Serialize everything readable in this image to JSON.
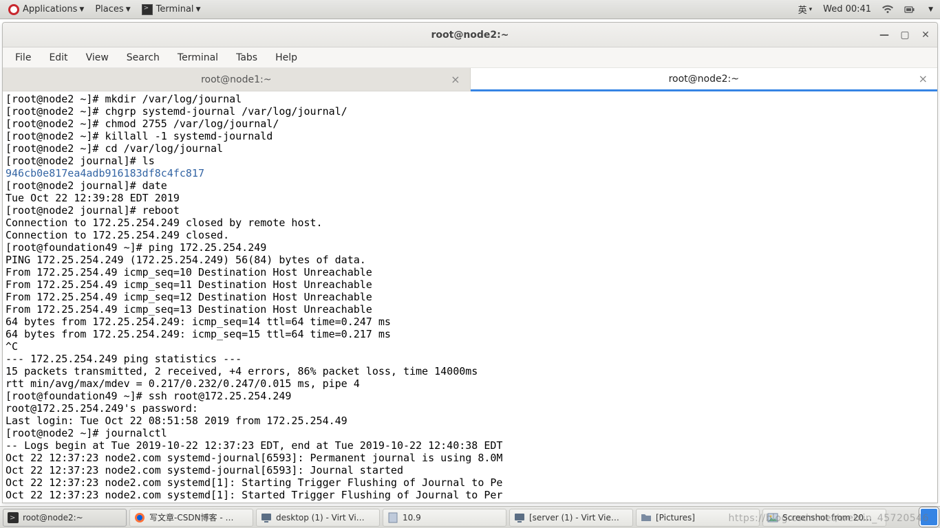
{
  "topbar": {
    "applications": "Applications",
    "places": "Places",
    "terminal": "Terminal",
    "ime": "英",
    "clock": "Wed 00:41"
  },
  "window": {
    "title": "root@node2:~",
    "menus": [
      "File",
      "Edit",
      "View",
      "Search",
      "Terminal",
      "Tabs",
      "Help"
    ],
    "tabs": [
      {
        "label": "root@node1:~",
        "active": false
      },
      {
        "label": "root@node2:~",
        "active": true
      }
    ]
  },
  "terminal_lines": [
    {
      "t": "[root@node2 ~]# mkdir /var/log/journal"
    },
    {
      "t": "[root@node2 ~]# chgrp systemd-journal /var/log/journal/"
    },
    {
      "t": "[root@node2 ~]# chmod 2755 /var/log/journal/"
    },
    {
      "t": "[root@node2 ~]# killall -1 systemd-journald"
    },
    {
      "t": "[root@node2 ~]# cd /var/log/journal"
    },
    {
      "t": "[root@node2 journal]# ls"
    },
    {
      "t": "946cb0e817ea4adb916183df8c4fc817",
      "c": "blue"
    },
    {
      "t": "[root@node2 journal]# date"
    },
    {
      "t": "Tue Oct 22 12:39:28 EDT 2019"
    },
    {
      "t": "[root@node2 journal]# reboot"
    },
    {
      "t": "Connection to 172.25.254.249 closed by remote host."
    },
    {
      "t": "Connection to 172.25.254.249 closed."
    },
    {
      "t": "[root@foundation49 ~]# ping 172.25.254.249"
    },
    {
      "t": "PING 172.25.254.249 (172.25.254.249) 56(84) bytes of data."
    },
    {
      "t": "From 172.25.254.49 icmp_seq=10 Destination Host Unreachable"
    },
    {
      "t": "From 172.25.254.49 icmp_seq=11 Destination Host Unreachable"
    },
    {
      "t": "From 172.25.254.49 icmp_seq=12 Destination Host Unreachable"
    },
    {
      "t": "From 172.25.254.49 icmp_seq=13 Destination Host Unreachable"
    },
    {
      "t": "64 bytes from 172.25.254.249: icmp_seq=14 ttl=64 time=0.247 ms"
    },
    {
      "t": "64 bytes from 172.25.254.249: icmp_seq=15 ttl=64 time=0.217 ms"
    },
    {
      "t": "^C"
    },
    {
      "t": "--- 172.25.254.249 ping statistics ---"
    },
    {
      "t": "15 packets transmitted, 2 received, +4 errors, 86% packet loss, time 14000ms"
    },
    {
      "t": "rtt min/avg/max/mdev = 0.217/0.232/0.247/0.015 ms, pipe 4"
    },
    {
      "t": "[root@foundation49 ~]# ssh root@172.25.254.249"
    },
    {
      "t": "root@172.25.254.249's password:"
    },
    {
      "t": "Last login: Tue Oct 22 08:51:58 2019 from 172.25.254.49"
    },
    {
      "t": "[root@node2 ~]# journalctl"
    },
    {
      "t": "-- Logs begin at Tue 2019-10-22 12:37:23 EDT, end at Tue 2019-10-22 12:40:38 EDT"
    },
    {
      "t": "Oct 22 12:37:23 node2.com systemd-journal[6593]: Permanent journal is using 8.0M"
    },
    {
      "t": "Oct 22 12:37:23 node2.com systemd-journal[6593]: Journal started"
    },
    {
      "t": "Oct 22 12:37:23 node2.com systemd[1]: Starting Trigger Flushing of Journal to Pe"
    },
    {
      "t": "Oct 22 12:37:23 node2.com systemd[1]: Started Trigger Flushing of Journal to Per"
    }
  ],
  "taskbar": [
    {
      "label": "root@node2:~",
      "icon": "terminal",
      "active": true
    },
    {
      "label": "写文章-CSDN博客 - …",
      "icon": "firefox"
    },
    {
      "label": "desktop (1) - Virt Vi…",
      "icon": "vm"
    },
    {
      "label": "10.9",
      "icon": "doc"
    },
    {
      "label": "[server (1) - Virt Vie…",
      "icon": "vm"
    },
    {
      "label": "[Pictures]",
      "icon": "folder"
    },
    {
      "label": "Screenshot from 20…",
      "icon": "image"
    }
  ],
  "watermark": "https://blog.csdn.net/weixin_45720546"
}
